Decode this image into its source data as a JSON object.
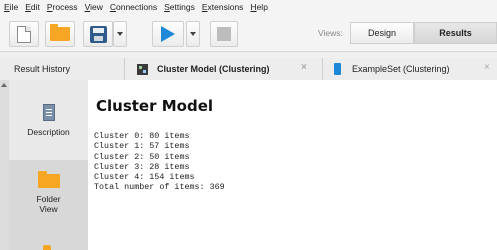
{
  "menubar": [
    {
      "key": "E",
      "rest": "ile"
    },
    {
      "key": "E",
      "rest": "dit"
    },
    {
      "key": "P",
      "rest": "rocess"
    },
    {
      "key": "V",
      "rest": "iew"
    },
    {
      "key": "C",
      "rest": "onnections"
    },
    {
      "key": "S",
      "rest": "ettings"
    },
    {
      "key": "E",
      "rest": "xtensions"
    },
    {
      "key": "H",
      "rest": "elp"
    }
  ],
  "toolbar": {
    "icons": [
      "new-process-icon",
      "open-folder-icon",
      "save-icon",
      "run-icon",
      "stop-icon"
    ],
    "views_label": "Views:",
    "design_label": "Design",
    "results_label": "Results"
  },
  "tabs": {
    "history": "Result History",
    "cluster": "Cluster Model (Clustering)",
    "exampleset": "ExampleSet (Clustering)",
    "close_glyph": "×"
  },
  "sidebar": {
    "description": "Description",
    "folder_view_line1": "Folder",
    "folder_view_line2": "View"
  },
  "content": {
    "title": "Cluster Model",
    "lines": [
      "Cluster 0: 80 items",
      "Cluster 1: 57 items",
      "Cluster 2: 50 items",
      "Cluster 3: 28 items",
      "Cluster 4: 154 items",
      "Total number of items: 369"
    ]
  },
  "colors": {
    "accent_blue": "#1e88d8",
    "folder_orange": "#f6a623"
  }
}
